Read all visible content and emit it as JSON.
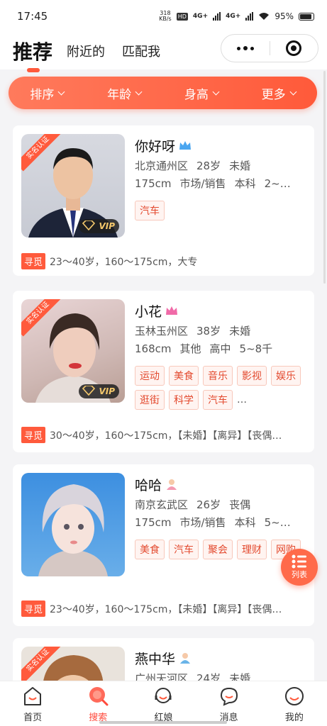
{
  "status": {
    "time": "17:45",
    "speed_top": "318",
    "speed_unit": "KB/s",
    "hd": "HD",
    "net1": "4G+",
    "net2": "4G+",
    "battery": "95%"
  },
  "nav": {
    "main_tab": "推荐",
    "tabs": [
      "附近的",
      "匹配我"
    ]
  },
  "filters": [
    "排序",
    "年龄",
    "身高",
    "更多"
  ],
  "cert_label": "实名认证",
  "vip_label": "VIP",
  "seek_label": "寻觅",
  "cards": [
    {
      "name": "你好呀",
      "crown_color": "#4aa6f0",
      "location": "北京通州区",
      "age": "28岁",
      "marital": "未婚",
      "height": "175cm",
      "job": "市场/销售",
      "edu": "本科",
      "income": "2~…",
      "tags": [
        "汽车"
      ],
      "more": "",
      "seek": "23～40岁，160～175cm，大专",
      "vip": true
    },
    {
      "name": "小花",
      "crown_color": "#f06aa8",
      "location": "玉林玉州区",
      "age": "38岁",
      "marital": "未婚",
      "height": "168cm",
      "job": "其他",
      "edu": "高中",
      "income": "5~8千",
      "tags": [
        "运动",
        "美食",
        "音乐",
        "影视",
        "娱乐",
        "逛街",
        "科学",
        "汽车"
      ],
      "more": "…",
      "seek": "30～40岁，160～175cm，【未婚】【离异】【丧偶…",
      "vip": true
    },
    {
      "name": "哈哈",
      "crown_color": "#f49ab2",
      "location": "南京玄武区",
      "age": "26岁",
      "marital": "丧偶",
      "height": "175cm",
      "job": "市场/销售",
      "edu": "本科",
      "income": "5~…",
      "tags": [
        "美食",
        "汽车",
        "聚会",
        "理财",
        "网购"
      ],
      "more": "",
      "seek": "23～40岁，160～175cm，【未婚】【离异】【丧偶…",
      "vip": false
    },
    {
      "name": "燕中华",
      "crown_color": "#6ab4e8",
      "location": "广州天河区",
      "age": "24岁",
      "marital": "未婚"
    }
  ],
  "fab_label": "列表",
  "bottom_nav": [
    "首页",
    "搜索",
    "红娘",
    "消息",
    "我的"
  ],
  "colors": {
    "accent": "#ff5a3c",
    "tag_text": "#e34a2f",
    "tag_bg": "#fff4f1"
  }
}
